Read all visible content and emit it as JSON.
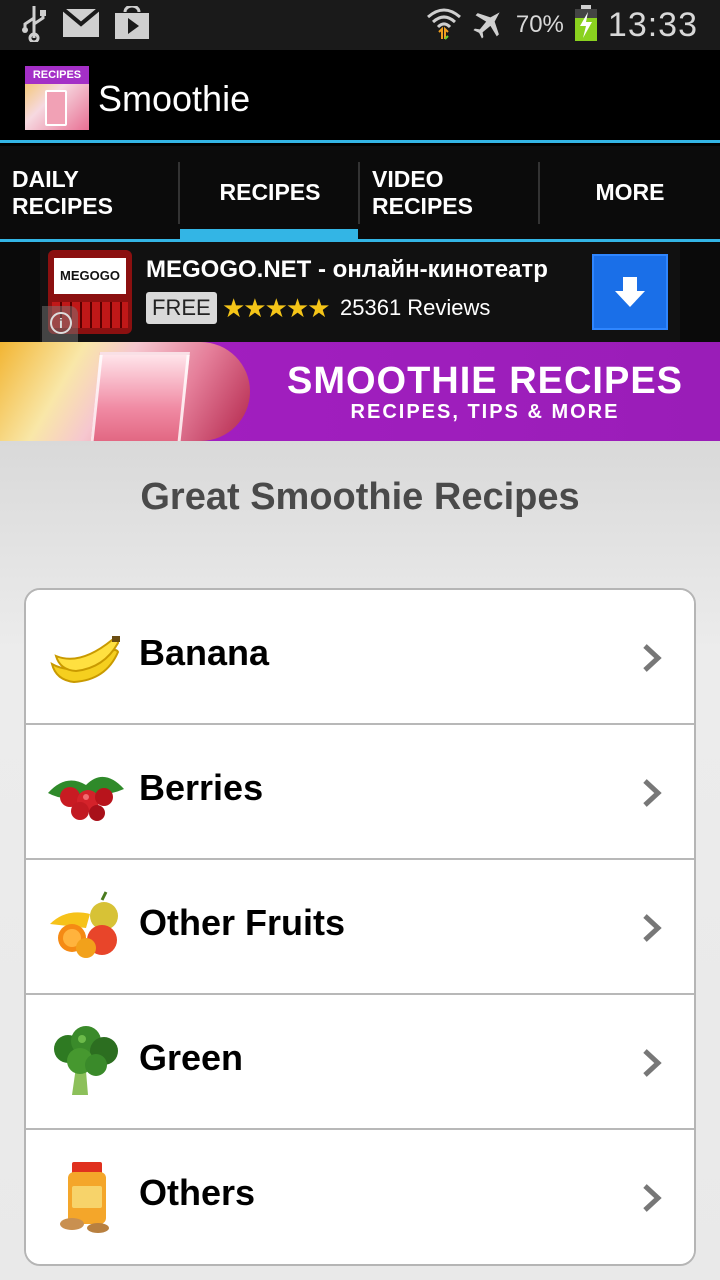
{
  "status_bar": {
    "battery_percent": "70%",
    "time": "13:33",
    "icons": [
      "usb-icon",
      "gmail-icon",
      "play-store-icon",
      "wifi-icon",
      "airplane-icon",
      "battery-charging-icon"
    ]
  },
  "action_bar": {
    "icon_tag": "RECIPES",
    "title": "Smoothie"
  },
  "tabs": [
    {
      "label": "DAILY RECIPES",
      "active": false
    },
    {
      "label": "RECIPES",
      "active": true
    },
    {
      "label": "VIDEO RECIPES",
      "active": false
    },
    {
      "label": "MORE",
      "active": false
    }
  ],
  "ad": {
    "logo_text": "MEGOGO",
    "title": "MEGOGO.NET - онлайн-кинотеатр",
    "price": "FREE",
    "stars": "★★★★★",
    "rating": 4.5,
    "reviews": "25361 Reviews"
  },
  "banner": {
    "title": "SMOOTHIE RECIPES",
    "subtitle": "RECIPES, TIPS & MORE"
  },
  "main": {
    "heading": "Great Smoothie Recipes",
    "items": [
      {
        "label": "Banana",
        "icon": "banana-icon"
      },
      {
        "label": "Berries",
        "icon": "berries-icon"
      },
      {
        "label": "Other Fruits",
        "icon": "fruits-icon"
      },
      {
        "label": "Green",
        "icon": "broccoli-icon"
      },
      {
        "label": "Others",
        "icon": "jar-icon"
      }
    ]
  },
  "colors": {
    "accent": "#33b5e5",
    "banner_purple": "#a41fc2",
    "download_blue": "#1a6fe8"
  }
}
